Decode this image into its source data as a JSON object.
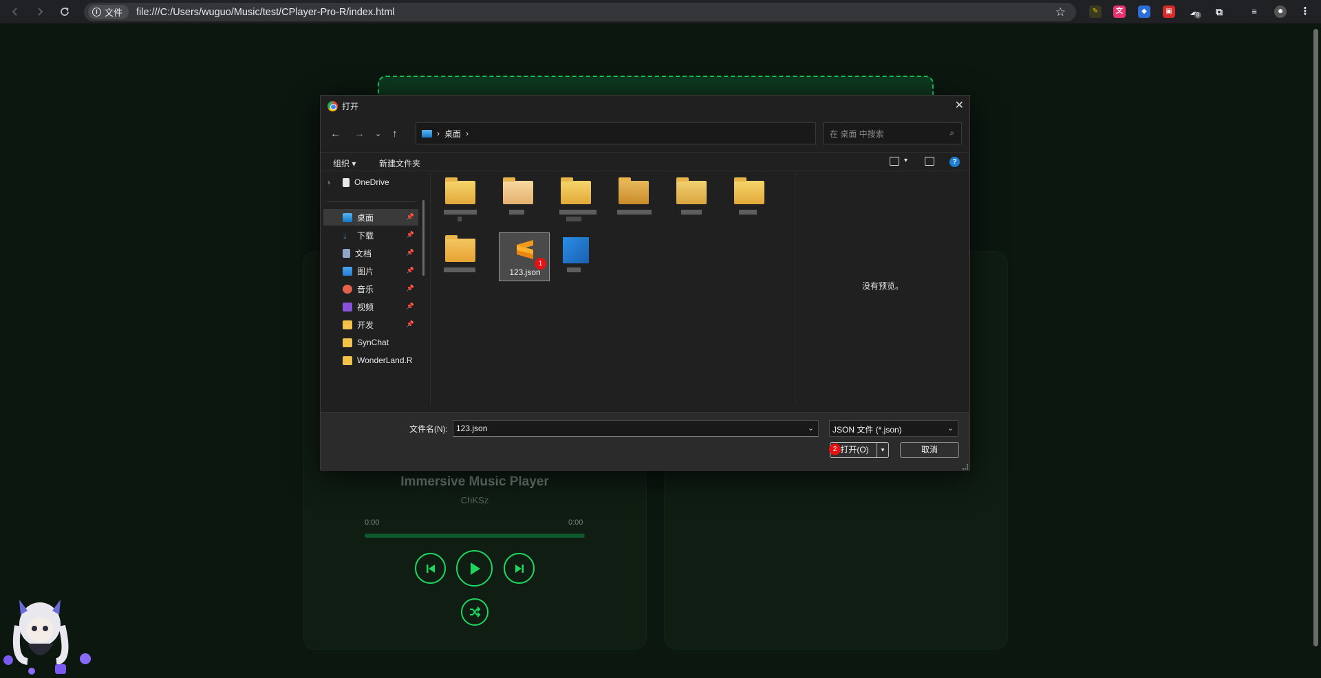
{
  "browser": {
    "site_chip": "文件",
    "url": "file:///C:/Users/wuguo/Music/test/CPlayer-Pro-R/index.html",
    "cloud_badge": "0"
  },
  "player": {
    "title": "Immersive Music Player",
    "artist": "ChKSz",
    "current_time": "0:00",
    "duration": "0:00",
    "progress": 0,
    "accent": "#1ed760"
  },
  "dialog": {
    "title": "打开",
    "path_segment": "桌面",
    "search_placeholder": "在 桌面 中搜索",
    "organize": "组织",
    "new_folder": "新建文件夹",
    "onedrive": "OneDrive",
    "nav_items": [
      {
        "label": "桌面",
        "icon": "desktop-icon",
        "pinned": true
      },
      {
        "label": "下载",
        "icon": "download-icon",
        "pinned": true
      },
      {
        "label": "文档",
        "icon": "document-icon",
        "pinned": true
      },
      {
        "label": "图片",
        "icon": "pictures-icon",
        "pinned": true
      },
      {
        "label": "音乐",
        "icon": "music-icon",
        "pinned": true
      },
      {
        "label": "视频",
        "icon": "video-icon",
        "pinned": true
      },
      {
        "label": "开发",
        "icon": "folder-icon",
        "pinned": true
      },
      {
        "label": "SynChat",
        "icon": "folder-icon",
        "pinned": false
      },
      {
        "label": "WonderLand.R",
        "icon": "folder-icon",
        "pinned": false
      }
    ],
    "selected_file": "123.json",
    "preview_text": "没有预览。",
    "filename_label": "文件名(N):",
    "filename_value": "123.json",
    "filetype": "JSON 文件 (*.json)",
    "open_button": "打开(O)",
    "cancel_button": "取消",
    "badge_1": "1",
    "badge_2": "2"
  }
}
